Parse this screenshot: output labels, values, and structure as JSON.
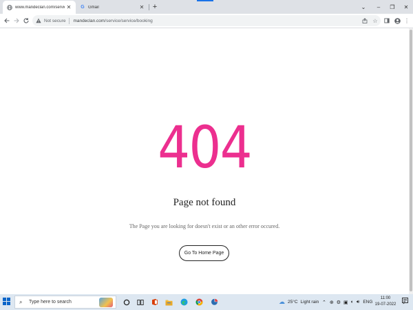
{
  "browser": {
    "tabs": [
      {
        "title": "www.mandeclan.com/service/se",
        "favicon": "globe-icon",
        "active": true
      },
      {
        "title": "Gmail",
        "favicon": "google-icon",
        "active": false
      }
    ],
    "new_tab_symbol": "+",
    "window_controls": {
      "dropdown": "⌄",
      "minimize": "–",
      "maximize": "❐",
      "close": "✕"
    },
    "address": {
      "security_label": "Not secure",
      "url_host": "mandeclan.com",
      "url_path": "/service/service/booking"
    },
    "accent_color": "#1a73e8"
  },
  "page": {
    "error_code": "404",
    "title": "Page not found",
    "description": "The Page you are looking for doesn't exist or an other error occured.",
    "home_button_label": "Go To Home Page",
    "accent_color": "#ec2f8f"
  },
  "taskbar": {
    "search_placeholder": "Type here to search",
    "weather": {
      "temperature": "25°C",
      "condition": "Light rain"
    },
    "language": "ENG",
    "time": "11:00",
    "date": "19-07-2022",
    "pinned_icons": [
      "cortana-icon",
      "task-view-icon",
      "office-icon",
      "file-explorer-icon",
      "edge-icon",
      "chrome-icon",
      "app-icon"
    ]
  }
}
